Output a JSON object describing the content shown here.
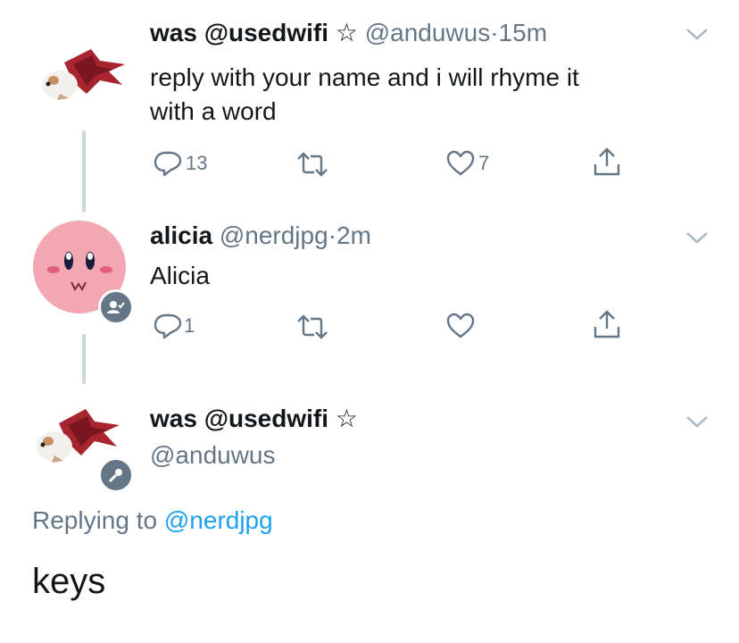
{
  "colors": {
    "text": "#14171a",
    "secondary": "#657786",
    "link": "#1da1f2",
    "thread_line": "#ccd6dd",
    "kirby_pink": "#f3a7b3"
  },
  "tweets": [
    {
      "display_name": "was @usedwifi",
      "star": "☆",
      "handle": "@anduwus",
      "separator": "·",
      "time": "15m",
      "text_line1": "reply with your name and i will rhyme it",
      "text_line2": "with a word",
      "reply_count": "13",
      "retweet_count": "",
      "like_count": "7"
    },
    {
      "display_name": "alicia",
      "handle": "@nerdjpg",
      "separator": "·",
      "time": "2m",
      "text": "Alicia",
      "reply_count": "1",
      "retweet_count": "",
      "like_count": ""
    }
  ],
  "focused_tweet": {
    "display_name": "was @usedwifi",
    "star": "☆",
    "handle": "@anduwus",
    "replying_prefix": "Replying to",
    "replying_handle": "@nerdjpg",
    "text": "keys"
  },
  "icons": {
    "reply": "reply-icon",
    "retweet": "retweet-icon",
    "like": "heart-icon",
    "share": "share-icon",
    "caret": "chevron-down-icon"
  }
}
